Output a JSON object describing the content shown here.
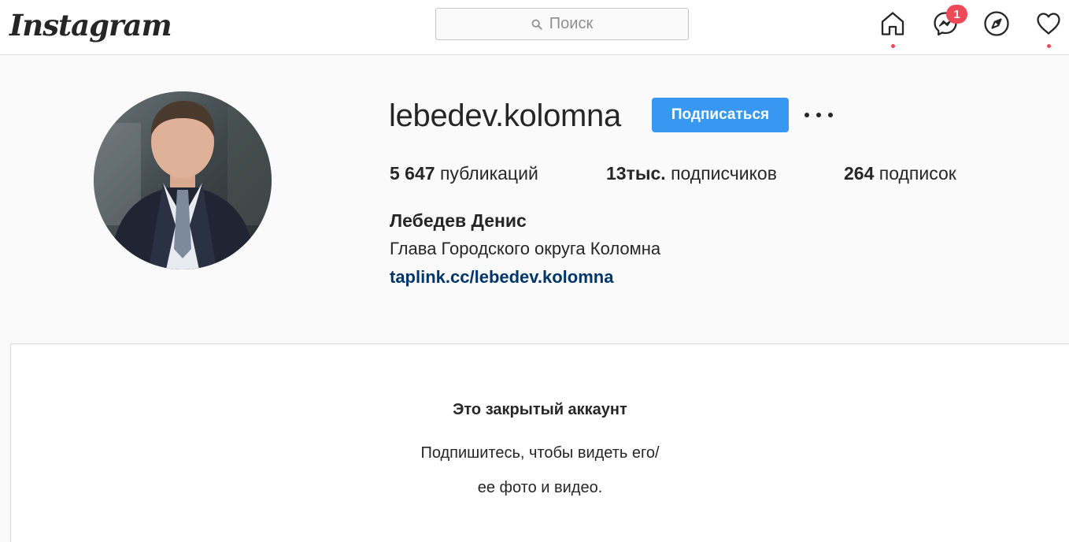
{
  "header": {
    "logo_text": "Instagram",
    "search_placeholder": "Поиск",
    "messages_badge": "1",
    "accent_color": "#ed4956"
  },
  "nav_icons": [
    "home-icon",
    "messenger-icon",
    "explore-compass-icon",
    "heart-icon"
  ],
  "profile": {
    "username": "lebedev.kolomna",
    "follow_label": "Подписаться",
    "more_label": "•••",
    "stats": {
      "posts_value": "5 647",
      "posts_label": "публикаций",
      "followers_value": "13тыс.",
      "followers_label": "подписчиков",
      "following_value": "264",
      "following_label": "подписок"
    },
    "full_name": "Лебедев Денис",
    "bio": "Глава Городского округа Коломна",
    "link": "taplink.cc/lebedev.kolomna",
    "link_color": "#003569",
    "button_color": "#3897f0"
  },
  "private_notice": {
    "title": "Это закрытый аккаунт",
    "line1": "Подпишитесь, чтобы видеть его/",
    "line2": "ее фото и видео."
  }
}
